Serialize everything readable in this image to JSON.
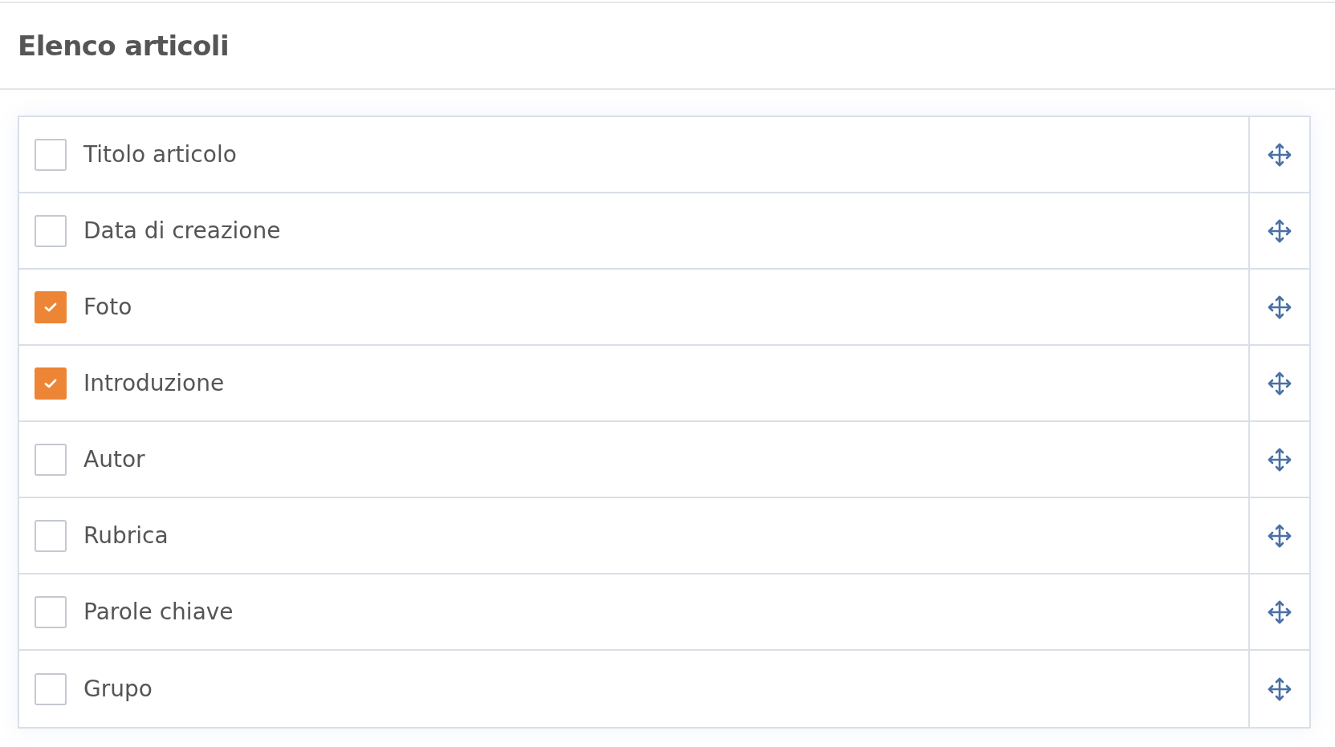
{
  "title": "Elenco articoli",
  "items": [
    {
      "label": "Titolo articolo",
      "checked": false
    },
    {
      "label": "Data di creazione",
      "checked": false
    },
    {
      "label": "Foto",
      "checked": true
    },
    {
      "label": "Introduzione",
      "checked": true
    },
    {
      "label": "Autor",
      "checked": false
    },
    {
      "label": "Rubrica",
      "checked": false
    },
    {
      "label": "Parole chiave",
      "checked": false
    },
    {
      "label": "Grupo",
      "checked": false
    }
  ]
}
